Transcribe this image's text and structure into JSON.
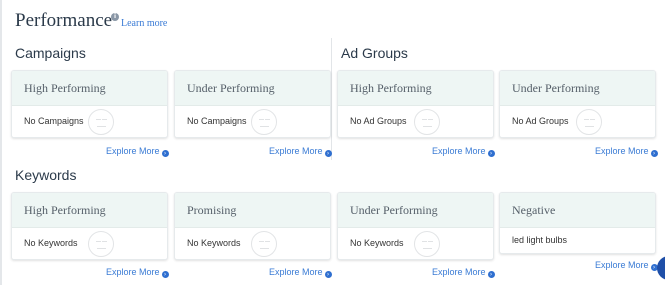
{
  "header": {
    "title": "Performance",
    "learn_more": "Learn more"
  },
  "sections": {
    "campaigns": "Campaigns",
    "ad_groups": "Ad Groups",
    "keywords": "Keywords"
  },
  "cards": {
    "campaigns_high": {
      "title": "High Performing",
      "body": "No Campaigns"
    },
    "campaigns_under": {
      "title": "Under Performing",
      "body": "No Campaigns"
    },
    "adgroups_high": {
      "title": "High Performing",
      "body": "No Ad Groups"
    },
    "adgroups_under": {
      "title": "Under Performing",
      "body": "No Ad Groups"
    },
    "keywords_high": {
      "title": "High Performing",
      "body": "No Keywords"
    },
    "keywords_promising": {
      "title": "Promising",
      "body": "No Keywords"
    },
    "keywords_under": {
      "title": "Under Performing",
      "body": "No Keywords"
    },
    "keywords_negative": {
      "title": "Negative",
      "body": "led light bulbs"
    }
  },
  "explore_more": "Explore More",
  "icons": {
    "info": "info-icon",
    "arrow": "arrow-right-circle-icon",
    "face": "neutral-face-icon",
    "chat": "chat-icon"
  }
}
